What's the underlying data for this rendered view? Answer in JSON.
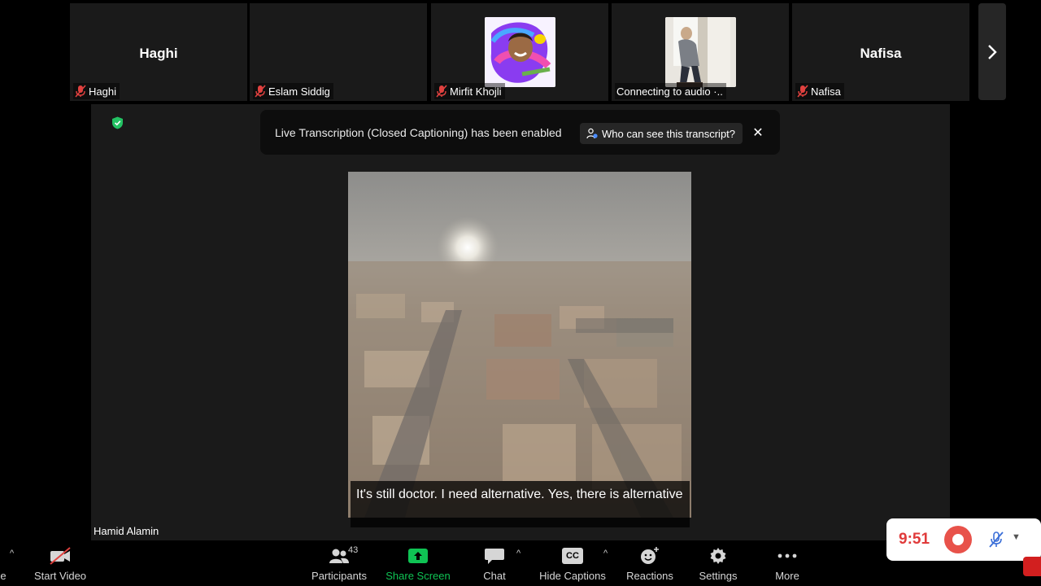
{
  "participants": [
    {
      "big_name": "Haghi",
      "label": "Haghi",
      "muted": true,
      "has_avatar": false
    },
    {
      "big_name": "",
      "label": "Eslam Siddig",
      "muted": true,
      "has_avatar": false
    },
    {
      "big_name": "",
      "label": "Mirfit Khojli",
      "muted": true,
      "has_avatar": true
    },
    {
      "big_name": "",
      "label": "Connecting to audio ·..",
      "muted": false,
      "has_avatar": true
    },
    {
      "big_name": "Nafisa",
      "label": "Nafisa",
      "muted": true,
      "has_avatar": false
    }
  ],
  "banner": {
    "text": "Live Transcription (Closed Captioning) has been enabled",
    "who_button": "Who can see this transcript?",
    "close": "✕"
  },
  "caption": {
    "text": "It's still doctor. I need alternative. Yes, there is alternative"
  },
  "speaker_name": "Hamid Alamin",
  "toolbar": {
    "start_video": "Start Video",
    "participants": "Participants",
    "participants_count": "43",
    "share_screen": "Share Screen",
    "chat": "Chat",
    "hide_captions": "Hide Captions",
    "cc_icon_text": "CC",
    "reactions": "Reactions",
    "settings": "Settings",
    "more": "More",
    "left_partial": "e"
  },
  "recording": {
    "time": "9:51"
  },
  "colors": {
    "share_green": "#0fc354",
    "record_red": "#e8524a",
    "mute_red": "#e0413f",
    "shield_green": "#23c263"
  },
  "icons": {
    "next": "chevron-right-icon",
    "shield": "shield-check-icon",
    "mic_muted": "mic-off-icon"
  }
}
